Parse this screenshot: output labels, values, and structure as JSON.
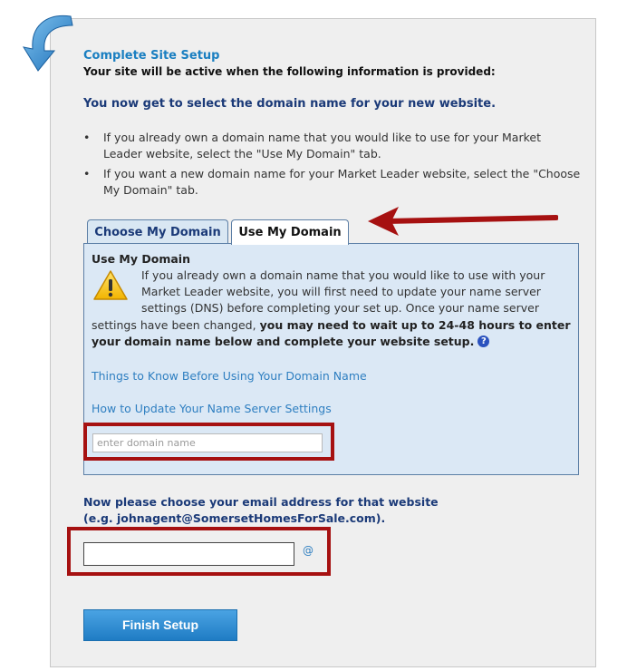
{
  "setup": {
    "title": "Complete Site Setup",
    "subtitle": "Your site will be active when the following information is provided:",
    "headline": "You now get to select the domain name for your new website.",
    "bullets": [
      "If you already own a domain name that you would like to use for your Market Leader website, select the \"Use My Domain\" tab.",
      "If you want a new domain name for your Market Leader website, select the \"Choose My Domain\" tab."
    ],
    "bullet_glyph": "•"
  },
  "tabs": {
    "choose_label": "Choose My Domain",
    "use_label": "Use My Domain",
    "active": "Use My Domain"
  },
  "use_my_domain": {
    "heading": "Use My Domain",
    "intro": "If you already own a domain name that you would like to use with your Market Leader website, you will first need to update your name server settings (DNS) before completing your set up. Once your name server settings have been changed,",
    "emphasis": "you may need to wait up to 24-48 hours to enter your domain name below and complete your website setup.",
    "help_glyph": "?",
    "link_things_to_know": "Things to Know Before Using Your Domain Name",
    "link_update_ns": "How to Update Your Name Server Settings",
    "domain_input": {
      "value": "",
      "placeholder": "enter domain name"
    }
  },
  "email": {
    "prompt_line1": "Now please choose your email address for that website",
    "prompt_line2": "(e.g. johnagent@SomersetHomesForSale.com).",
    "input_value": "",
    "at_sign": "@"
  },
  "finish_button": "Finish Setup",
  "icons": {
    "back_arrow": "curved-arrow-icon",
    "warning": "warning-icon",
    "help": "help-icon",
    "annotation_arrow": "red-arrow-icon"
  },
  "colors": {
    "title_blue": "#1a7fc1",
    "navy": "#1b3a78",
    "tab_body_bg": "#dbe8f5",
    "highlight_red": "#a61111",
    "button_blue": "#1f7cc4"
  }
}
